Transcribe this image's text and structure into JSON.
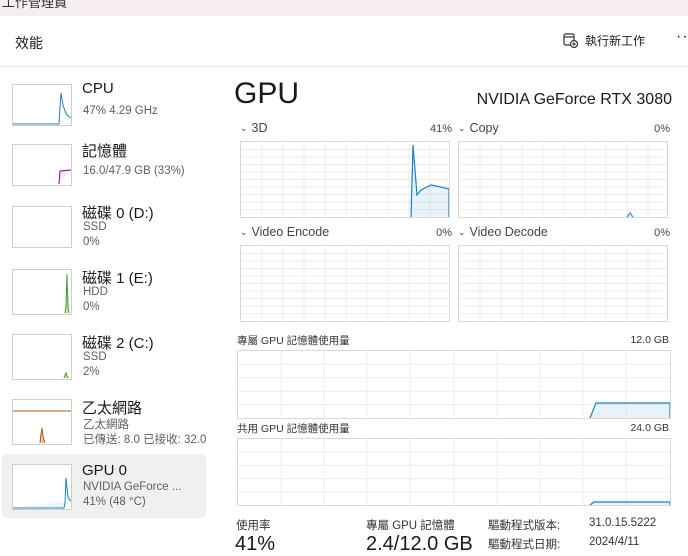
{
  "header": {
    "title": "效能",
    "run_task_label": "執行新工作",
    "more_label": "···",
    "top_cut_text": "工作管理員"
  },
  "sidebar": {
    "items": [
      {
        "name": "CPU",
        "sub1": "47%  4.29 GHz",
        "sub2": ""
      },
      {
        "name": "記憶體",
        "sub1": "16.0/47.9 GB (33%)",
        "sub2": ""
      },
      {
        "name": "磁碟 0 (D:)",
        "sub1": "SSD",
        "sub2": "0%"
      },
      {
        "name": "磁碟 1 (E:)",
        "sub1": "HDD",
        "sub2": "0%"
      },
      {
        "name": "磁碟 2 (C:)",
        "sub1": "SSD",
        "sub2": "2%"
      },
      {
        "name": "乙太網路",
        "sub1": "乙太網路",
        "sub2": "已傳送: 8.0  已接收: 32.0"
      },
      {
        "name": "GPU 0",
        "sub1": "NVIDIA GeForce ...",
        "sub2": "41% (48 °C)"
      }
    ]
  },
  "main": {
    "title": "GPU",
    "model": "NVIDIA GeForce RTX 3080",
    "engines": [
      {
        "label": "3D",
        "value": "41%"
      },
      {
        "label": "Copy",
        "value": "0%"
      },
      {
        "label": "Video Encode",
        "value": "0%"
      },
      {
        "label": "Video Decode",
        "value": "0%"
      }
    ],
    "dedicated": {
      "label": "專屬 GPU 記憶體使用量",
      "max": "12.0 GB"
    },
    "shared": {
      "label": "共用 GPU 記憶體使用量",
      "max": "24.0 GB"
    },
    "stats": {
      "util_label": "使用率",
      "util_value": "41%",
      "mem_label": "專屬 GPU 記憶體",
      "mem_value": "2.4/12.0 GB",
      "driver_version_label": "驅動程式版本:",
      "driver_version": "31.0.15.5222",
      "driver_date_label": "驅動程式日期:",
      "driver_date": "2024/4/11"
    }
  },
  "colors": {
    "cpu": "#1f7fc9",
    "memory": "#8b2b9e",
    "disk": "#4f9a2a",
    "ethernet": "#a85f15",
    "gpu": "#1f7fc9"
  }
}
